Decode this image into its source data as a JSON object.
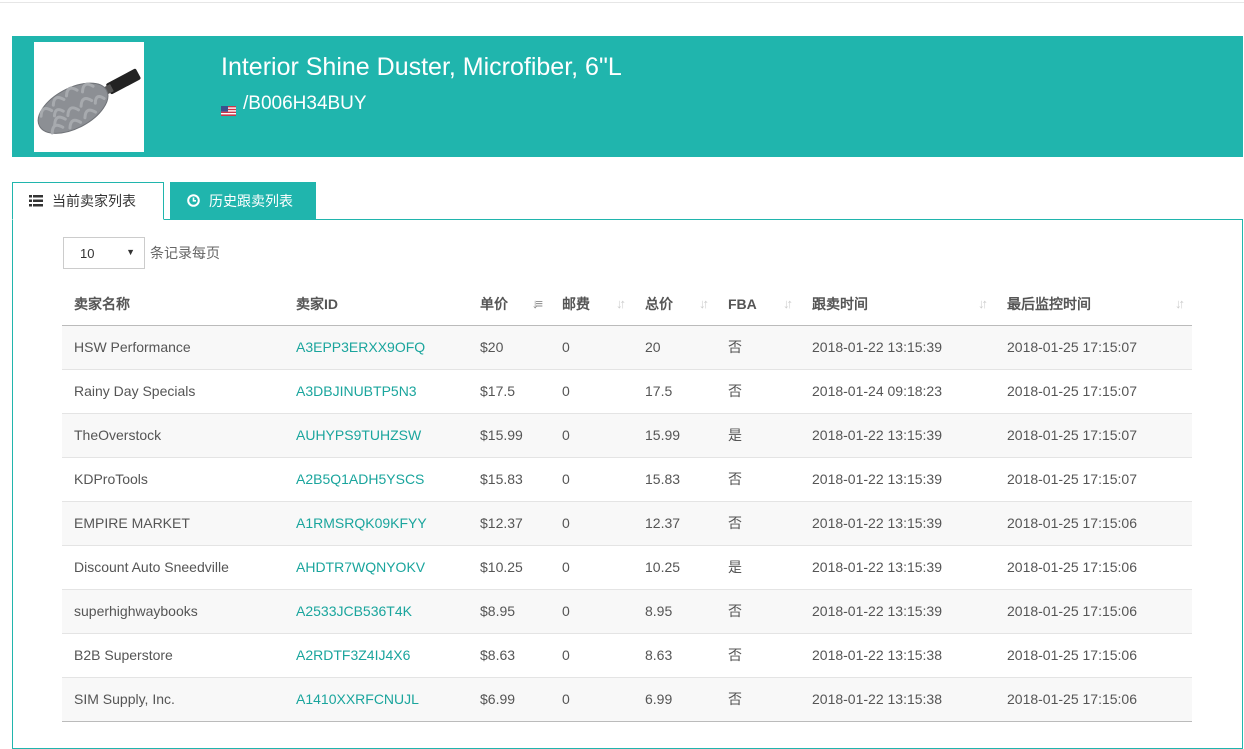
{
  "product": {
    "title": "Interior Shine Duster, Microfiber, 6\"L",
    "asin": "/B006H34BUY",
    "image_alt": "microfiber duster product image"
  },
  "tabs": [
    {
      "label": "当前卖家列表",
      "icon": "list-icon",
      "active": true
    },
    {
      "label": "历史跟卖列表",
      "icon": "clock-icon",
      "active": false
    }
  ],
  "page_length": {
    "value": "10",
    "suffix": "条记录每页"
  },
  "table": {
    "headers": [
      "卖家名称",
      "卖家ID",
      "单价",
      "邮费",
      "总价",
      "FBA",
      "跟卖时间",
      "最后监控时间"
    ],
    "rows": [
      [
        "HSW Performance",
        "A3EPP3ERXX9OFQ",
        "$20",
        "0",
        "20",
        "否",
        "2018-01-22 13:15:39",
        "2018-01-25 17:15:07"
      ],
      [
        "Rainy Day Specials",
        "A3DBJINUBTP5N3",
        "$17.5",
        "0",
        "17.5",
        "否",
        "2018-01-24 09:18:23",
        "2018-01-25 17:15:07"
      ],
      [
        "TheOverstock",
        "AUHYPS9TUHZSW",
        "$15.99",
        "0",
        "15.99",
        "是",
        "2018-01-22 13:15:39",
        "2018-01-25 17:15:07"
      ],
      [
        "KDProTools",
        "A2B5Q1ADH5YSCS",
        "$15.83",
        "0",
        "15.83",
        "否",
        "2018-01-22 13:15:39",
        "2018-01-25 17:15:07"
      ],
      [
        "EMPIRE MARKET",
        "A1RMSRQK09KFYY",
        "$12.37",
        "0",
        "12.37",
        "否",
        "2018-01-22 13:15:39",
        "2018-01-25 17:15:06"
      ],
      [
        "Discount Auto Sneedville",
        "AHDTR7WQNYOKV",
        "$10.25",
        "0",
        "10.25",
        "是",
        "2018-01-22 13:15:39",
        "2018-01-25 17:15:06"
      ],
      [
        "superhighwaybooks",
        "A2533JCB536T4K",
        "$8.95",
        "0",
        "8.95",
        "否",
        "2018-01-22 13:15:39",
        "2018-01-25 17:15:06"
      ],
      [
        "B2B Superstore",
        "A2RDTF3Z4IJ4X6",
        "$8.63",
        "0",
        "8.63",
        "否",
        "2018-01-22 13:15:38",
        "2018-01-25 17:15:06"
      ],
      [
        "SIM Supply, Inc.",
        "A1410XXRFCNUJL",
        "$6.99",
        "0",
        "6.99",
        "否",
        "2018-01-22 13:15:38",
        "2018-01-25 17:15:06"
      ]
    ]
  },
  "colors": {
    "accent": "#20b5ad",
    "link": "#1aa59d"
  }
}
